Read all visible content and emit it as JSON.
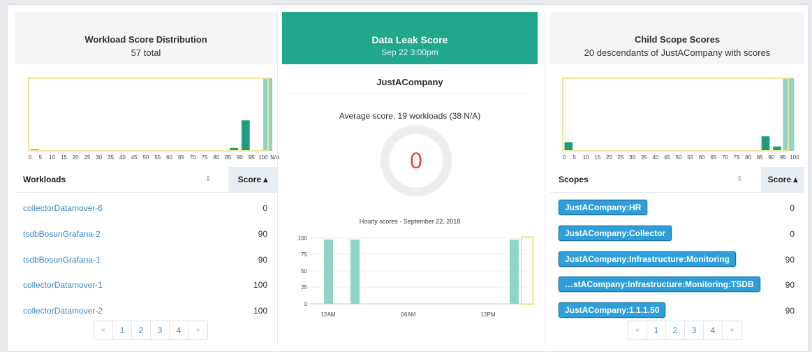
{
  "colors": {
    "accent": "#22a68c",
    "bar": "#1f9c7f",
    "bar_light": "#8fd5c6",
    "highlight": "#f3e49a",
    "link": "#3a88c5",
    "score_zero": "#e8453c",
    "tag": "#2e9fd8"
  },
  "workload_panel": {
    "title": "Workload Score Distribution",
    "subtitle": "57 total",
    "histogram": {
      "tick_labels": [
        "0",
        "5",
        "10",
        "15",
        "20",
        "25",
        "30",
        "35",
        "40",
        "45",
        "50",
        "55",
        "60",
        "65",
        "70",
        "75",
        "80",
        "85",
        "90",
        "95",
        "100",
        "N/A"
      ],
      "bars": [
        0.02,
        0,
        0,
        0,
        0,
        0,
        0,
        0,
        0,
        0,
        0,
        0,
        0,
        0,
        0,
        0,
        0,
        0.04,
        0.42,
        0,
        1.0
      ]
    },
    "col_name": "Workloads",
    "col_score": "Score ▴",
    "rows": [
      {
        "name": "collectorDatamover-6",
        "score": "0"
      },
      {
        "name": "tsdbBosunGrafana-2",
        "score": "90"
      },
      {
        "name": "tsdbBosunGrafana-1",
        "score": "90"
      },
      {
        "name": "collectorDatamover-1",
        "score": "100"
      },
      {
        "name": "collectorDatamover-2",
        "score": "100"
      }
    ],
    "pager": [
      "«",
      "1",
      "2",
      "3",
      "4",
      "»"
    ]
  },
  "leak_panel": {
    "title": "Data Leak Score",
    "subtitle": "Sep 22 3:00pm",
    "company": "JustACompany",
    "average_label": "Average score, 19 workloads (38 N/A)",
    "score": "0",
    "hourly_title": "Hourly scores - September 22, 2018",
    "hourly_y_ticks": [
      "100",
      "75",
      "50",
      "25",
      "0"
    ],
    "hourly_x_ticks": [
      "12AM",
      "06AM",
      "12PM"
    ]
  },
  "child_panel": {
    "title": "Child Scope Scores",
    "subtitle": "20 descendants of JustACompany with scores",
    "histogram": {
      "tick_labels": [
        "0",
        "5",
        "10",
        "15",
        "20",
        "25",
        "30",
        "35",
        "40",
        "45",
        "50",
        "55",
        "60",
        "65",
        "70",
        "75",
        "80",
        "85",
        "90",
        "95",
        "100"
      ],
      "bars": [
        0.12,
        0,
        0,
        0,
        0,
        0,
        0,
        0,
        0,
        0,
        0,
        0,
        0,
        0,
        0,
        0,
        0,
        0.2,
        0.06,
        1.0
      ]
    },
    "col_name": "Scopes",
    "col_score": "Score ▴",
    "rows": [
      {
        "name": "JustACompany:HR",
        "score": "0"
      },
      {
        "name": "JustACompany:Collector",
        "score": "0"
      },
      {
        "name": "JustACompany:Infrastructure:Monitoring",
        "score": "90"
      },
      {
        "name": "…stACompany:Infrastructure:Monitoring:TSDB",
        "score": "90"
      },
      {
        "name": "JustACompany:1.1.1.50",
        "score": "90"
      }
    ],
    "pager": [
      "«",
      "1",
      "2",
      "3",
      "4",
      "»"
    ]
  }
}
